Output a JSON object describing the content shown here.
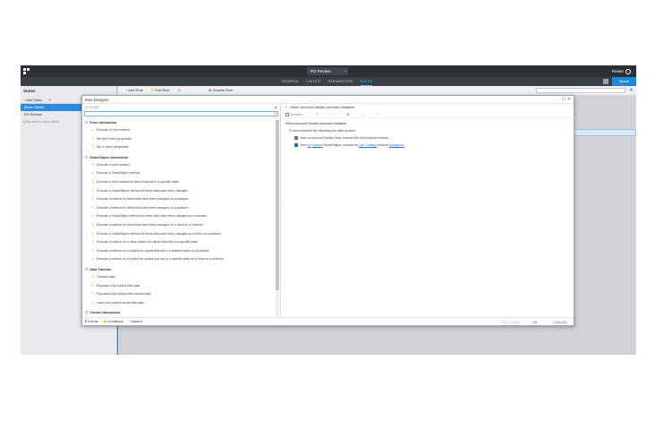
{
  "topbar": {
    "document_tab": "PO Review",
    "user_name": "Renier"
  },
  "navbar": {
    "tabs": [
      "GENERAL",
      "LAYOUT",
      "PARAMETERS",
      "RULES"
    ],
    "active_tab": "RULES",
    "save_label": "Sauce"
  },
  "states_panel": {
    "title": "States",
    "add_label": "Add State",
    "items": [
      "(Base State)",
      "PO Review"
    ],
    "hint": "(Click here to add a state)"
  },
  "rules_toolbar": {
    "add_label": "Add Rule",
    "edit_label": "Edit Rule",
    "disable_label": "Disable Rule"
  },
  "dialog": {
    "title": "Rule Designer",
    "actions_header": "ACTIONS",
    "groups": [
      {
        "name": "Form Interaction",
        "items": [
          "Execute a Form method",
          "Set the Form's properties",
          "Set a View's properties"
        ]
      },
      {
        "name": "SmartObject Interaction",
        "items": [
          "Execute a View method",
          "Execute a SmartObject method",
          "Execute a View method for items that are in a specific state",
          "Execute a SmartObject method for items that have been changed",
          "Execute a method for items that have been changed on a subview",
          "Execute a method for items that have been changed on a subform",
          "Execute a SmartObject method for items that have been changed on a subview",
          "Execute a method for items that have been changed on a View on a subform",
          "Execute a SmartObject method for items that have been changed on a View on a subform",
          "Execute a method on a View control for values that are in a specific state",
          "Execute a method on a control for values that are in a specific state on a subview",
          "Execute a method on a control for values that are in a specific state on a View on a subform"
        ]
      },
      {
        "name": "Data Transfer",
        "items": [
          "Transfer data",
          "Populate a list control with data",
          "Populate a list control with cached data",
          "Load a list control cache with data"
        ]
      },
      {
        "name": "Control Interaction",
        "items": []
      }
    ],
    "footer_tabs": [
      "Events",
      "Conditions",
      "Actions"
    ],
    "rule_name": "When Account Details executed Initialize",
    "rule_tools": [
      "Enabled"
    ],
    "rule_heading": "When Account Details executed Initialize",
    "rule_lines": {
      "line1": "then complete the following one after another",
      "line2": "then on Account Details View, execute the Get Account method",
      "line3_prefix": "then",
      "line3_on": "on",
      "line3_target": "Contact",
      "line3_mid": "SmartObject, execute its",
      "line3_method": "List Contacts",
      "line3_suffix": "method",
      "line3_config": "(configure)"
    },
    "buttons": {
      "settings": "SETTINGS",
      "ok": "OK",
      "cancel": "CANCEL"
    }
  }
}
